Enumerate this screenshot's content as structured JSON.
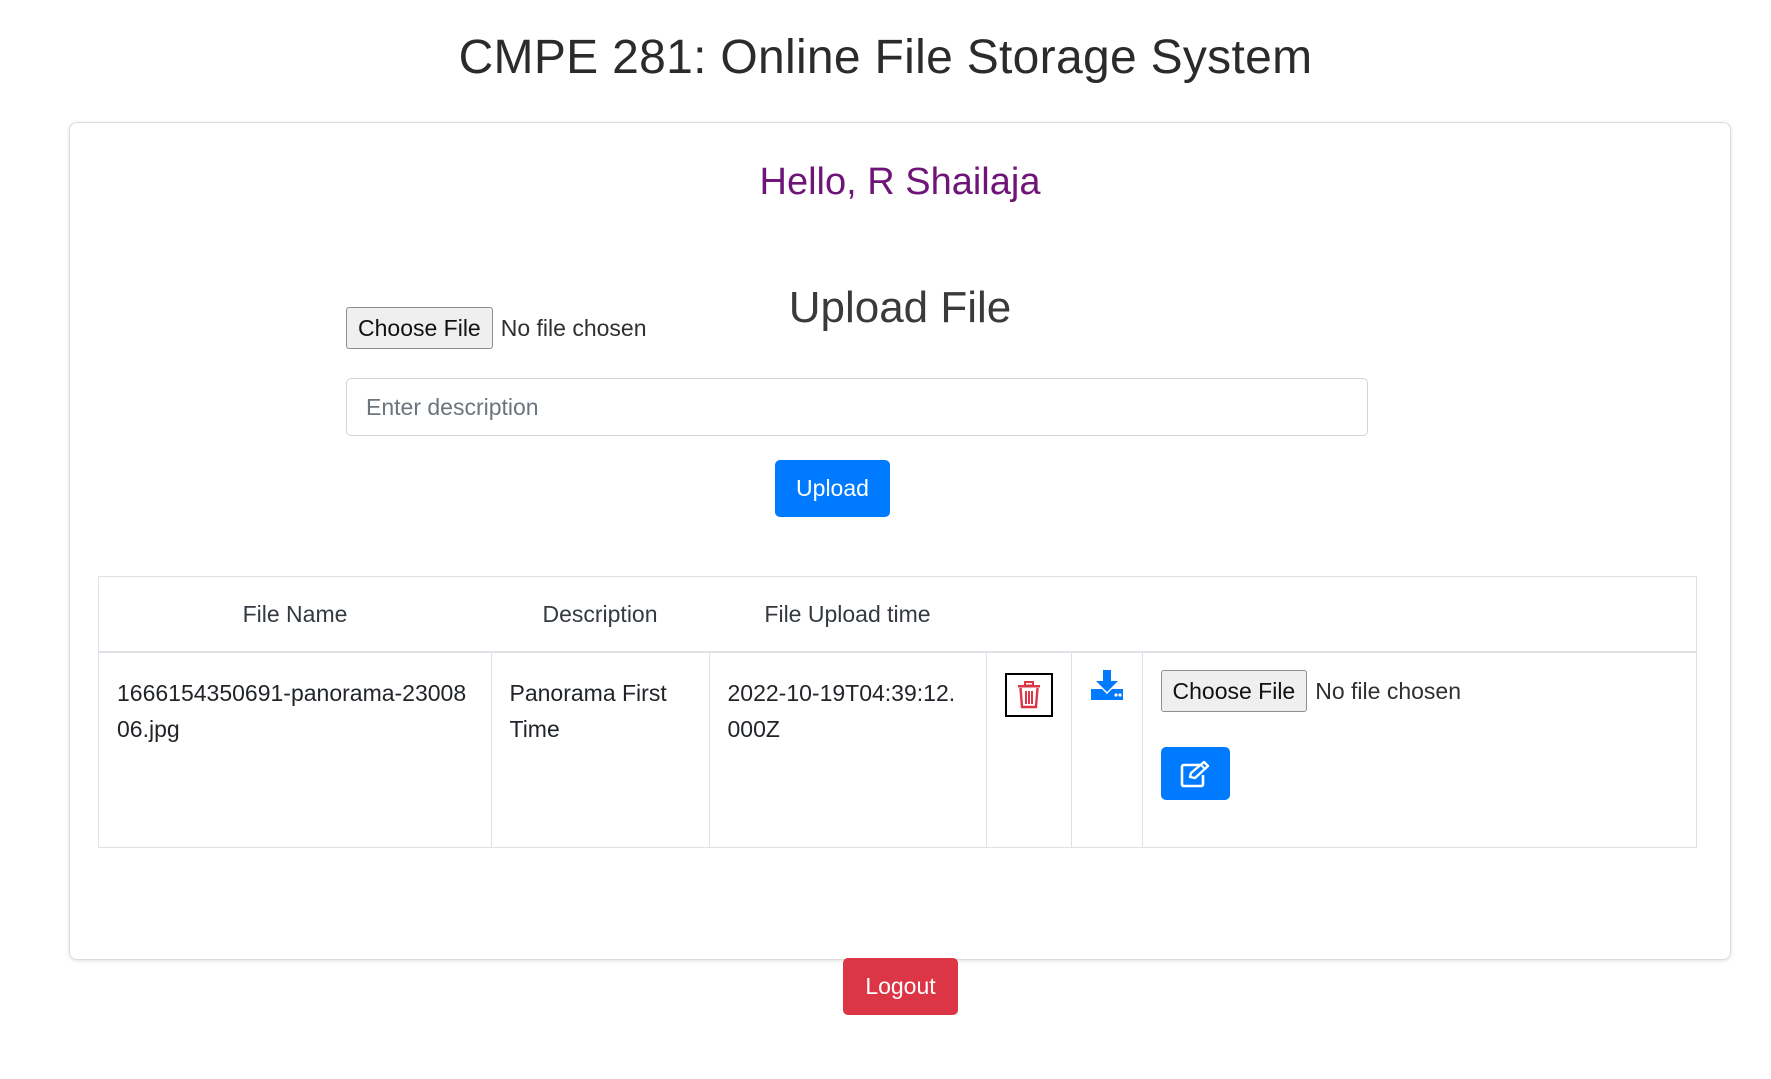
{
  "header": {
    "title": "CMPE 281: Online File Storage System"
  },
  "greeting": "Hello, R Shailaja",
  "upload": {
    "heading": "Upload File",
    "choose_file_label": "Choose File",
    "no_file_text": "No file chosen",
    "description_placeholder": "Enter description",
    "upload_label": "Upload"
  },
  "table": {
    "headers": [
      "File Name",
      "Description",
      "File Upload time"
    ],
    "rows": [
      {
        "file_name": "1666154350691-panorama-2300806.jpg",
        "description": "Panorama First Time",
        "upload_time": "2022-10-19T04:39:12.000Z",
        "delete_icon": "trash-icon",
        "download_icon": "download-icon",
        "choose_file_label": "Choose File",
        "no_file_text": "No file chosen",
        "edit_icon": "edit-icon"
      }
    ]
  },
  "logout_label": "Logout",
  "colors": {
    "primary": "#007bff",
    "danger": "#dc3545",
    "greeting": "#6f1578",
    "trash": "#dc3545"
  }
}
